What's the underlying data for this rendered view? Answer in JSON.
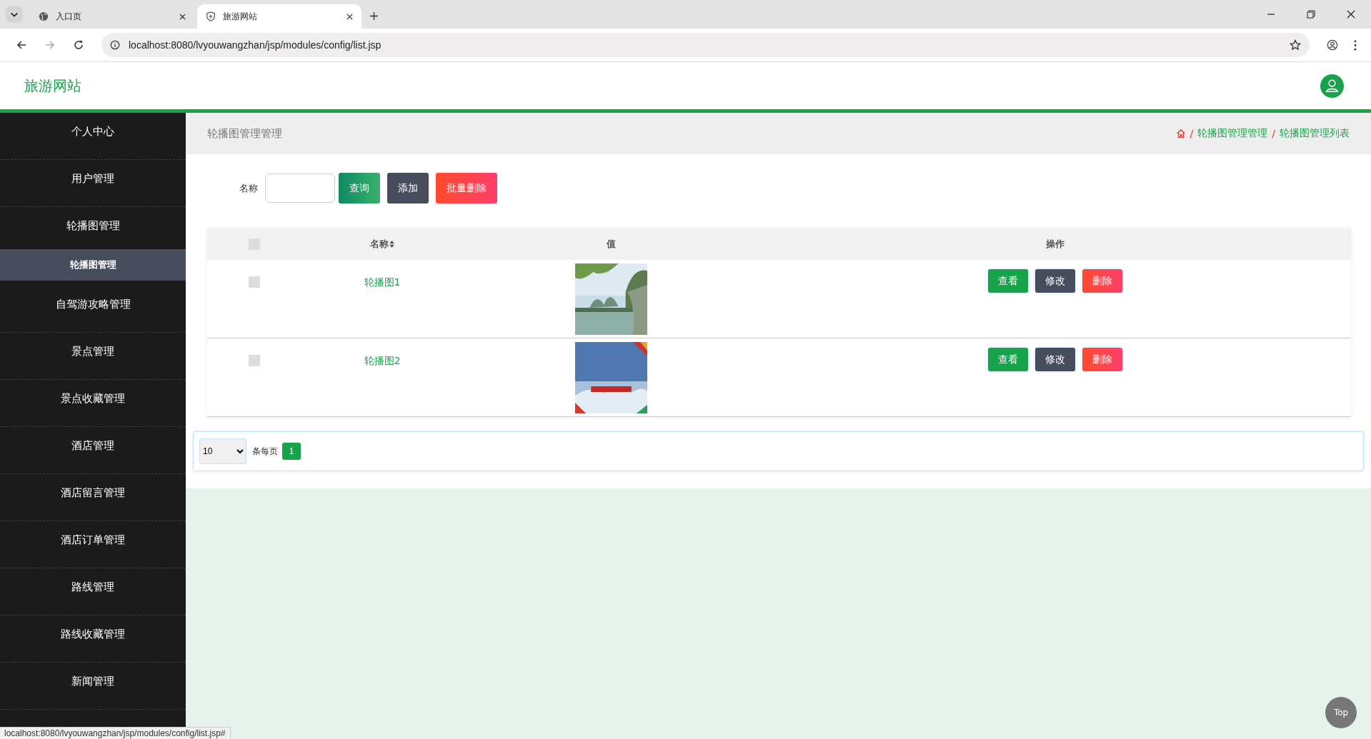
{
  "browser": {
    "tabs": [
      {
        "title": "入口页",
        "selected": false,
        "kind": "globe"
      },
      {
        "title": "旅游网站",
        "selected": true,
        "kind": "shield"
      }
    ],
    "url": "localhost:8080/lvyouwangzhan/jsp/modules/config/list.jsp"
  },
  "site": {
    "title": "旅游网站"
  },
  "sidebar": {
    "items": [
      {
        "label": "个人中心",
        "kind": "item",
        "selected": false
      },
      {
        "label": "用户管理",
        "kind": "item",
        "selected": false
      },
      {
        "label": "轮播图管理",
        "kind": "item",
        "selected": false
      },
      {
        "label": "轮播图管理",
        "kind": "sub",
        "selected": true
      },
      {
        "label": "自驾游攻略管理",
        "kind": "item",
        "selected": false
      },
      {
        "label": "景点管理",
        "kind": "item",
        "selected": false
      },
      {
        "label": "景点收藏管理",
        "kind": "item",
        "selected": false
      },
      {
        "label": "酒店管理",
        "kind": "item",
        "selected": false
      },
      {
        "label": "酒店留言管理",
        "kind": "item",
        "selected": false
      },
      {
        "label": "酒店订单管理",
        "kind": "item",
        "selected": false
      },
      {
        "label": "路线管理",
        "kind": "item",
        "selected": false
      },
      {
        "label": "路线收藏管理",
        "kind": "item",
        "selected": false
      },
      {
        "label": "新闻管理",
        "kind": "item",
        "selected": false
      }
    ]
  },
  "page_title": "轮播图管理管理",
  "breadcrumb": [
    {
      "separator": "/",
      "label": "轮播图管理管理"
    },
    {
      "separator": "/",
      "label": "轮播图管理列表"
    }
  ],
  "search": {
    "label": "名称",
    "buttons": [
      {
        "label": "查询",
        "kind": "search"
      },
      {
        "label": "添加",
        "kind": "add"
      },
      {
        "label": "批量删除",
        "kind": "delete"
      }
    ]
  },
  "table": {
    "select_all": {
      "checked": false
    },
    "columns": [
      "名称",
      "值",
      "操作"
    ],
    "rows": [
      {
        "checked": false,
        "name": "轮播图1",
        "actions": [
          {
            "label": "查看",
            "kind": "view"
          },
          {
            "label": "修改",
            "kind": "edit"
          },
          {
            "label": "删除",
            "kind": "delete"
          }
        ]
      },
      {
        "checked": false,
        "name": "轮播图2",
        "actions": [
          {
            "label": "查看",
            "kind": "view"
          },
          {
            "label": "修改",
            "kind": "edit"
          },
          {
            "label": "删除",
            "kind": "delete"
          }
        ]
      }
    ]
  },
  "pagination": {
    "page_size": "10",
    "per_page_label": "条每页",
    "pages": [
      {
        "label": "1",
        "selected": true
      }
    ]
  },
  "status_url": "localhost:8080/lvyouwangzhan/jsp/modules/config/list.jsp#",
  "top_button": "Top"
}
